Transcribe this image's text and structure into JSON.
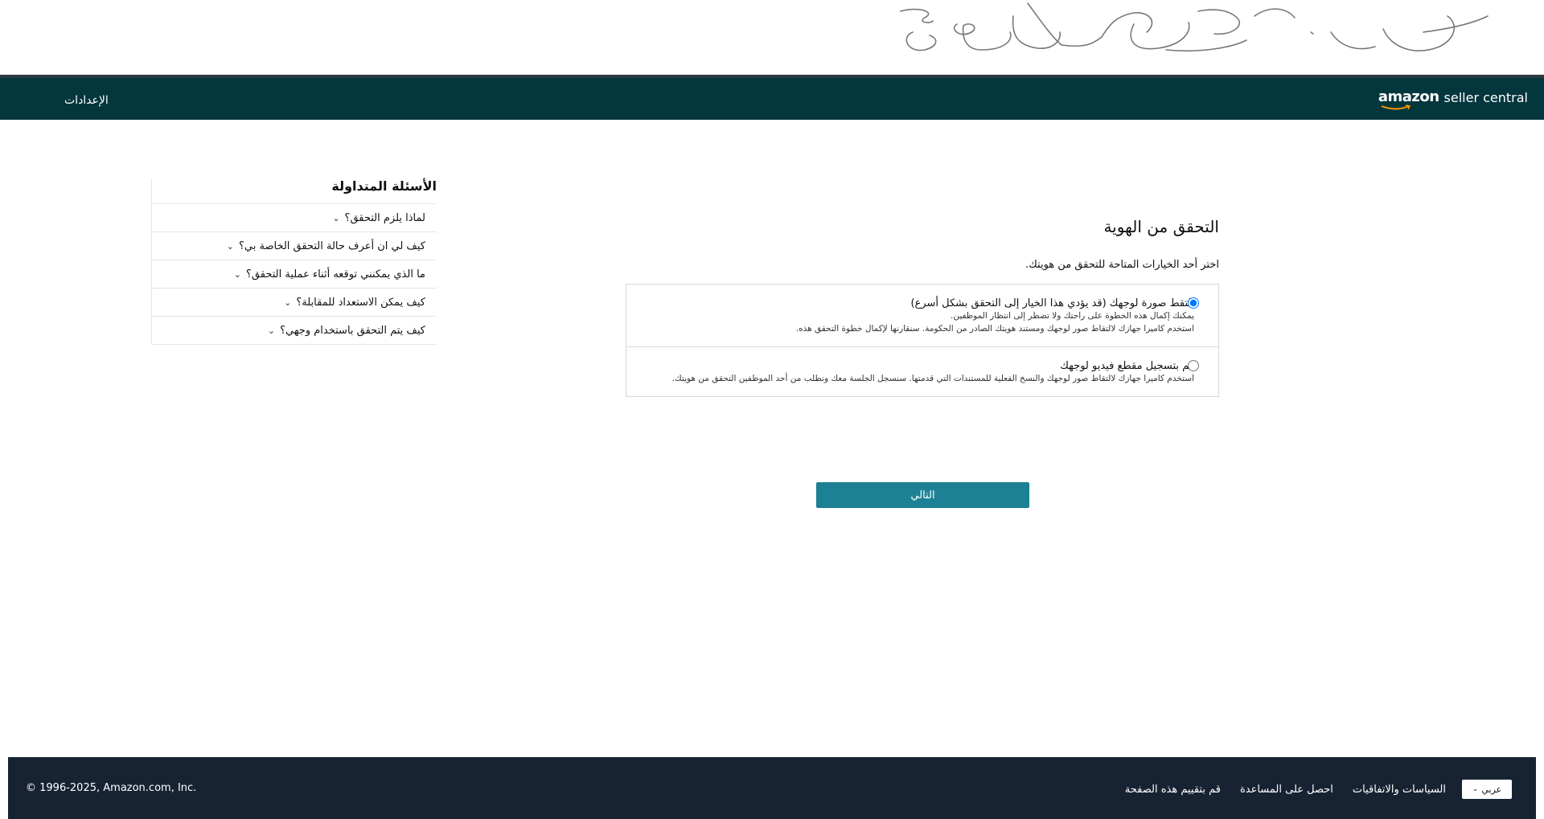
{
  "header": {
    "settings_label": "الإعدادات",
    "logo_amazon": "amazon",
    "logo_product": "seller central"
  },
  "faq": {
    "title": "الأسئلة المتداولة",
    "items": [
      "لماذا يلزم التحقق؟",
      "كيف لي ان أعرف حالة التحقق الخاصة بي؟",
      "ما الذي يمكنني توقعه أثناء عملية التحقق؟",
      "كيف يمكن الاستعداد للمقابلة؟",
      "كيف يتم التحقق باستخدام وجهي؟"
    ]
  },
  "main": {
    "title": "التحقق من الهوية",
    "subtitle": "اختر أحد الخيارات المتاحة للتحقق من هويتك.",
    "options": [
      {
        "title": "التقط صورة لوجهك (قد يؤدي هذا الخيار إلى التحقق بشكل أسرع)",
        "line1": "يمكنك إكمال هذه الخطوة على راحتك ولا تضطر إلى انتظار الموظفين.",
        "line2": "استخدم كاميرا جهازك لالتقاط صور لوجهك ومستند هويتك الصادر من الحكومة. سنقارنها لإكمال خطوة التحقق هذه.",
        "selected": true
      },
      {
        "title": "قم بتسجيل مقطع فيديو لوجهك",
        "line1": "استخدم كاميرا جهازك لالتقاط صور لوجهك والنسخ الفعلية للمستندات التي قدمتها. سنسجل الجلسة معك ونطلب من أحد الموظفين التحقق من هويتك.",
        "selected": false
      }
    ],
    "next_button": "التالي"
  },
  "footer": {
    "rate_page": "قم بتقييم هذه الصفحة",
    "get_help": "احصل على المساعدة",
    "policies": "السياسات والاتفاقيات",
    "language": "عربي",
    "copyright": "© 1996-2025, Amazon.com, Inc."
  },
  "colors": {
    "header_bg": "#03363d",
    "button_bg": "#1d8195",
    "footer_bg": "#172333"
  }
}
